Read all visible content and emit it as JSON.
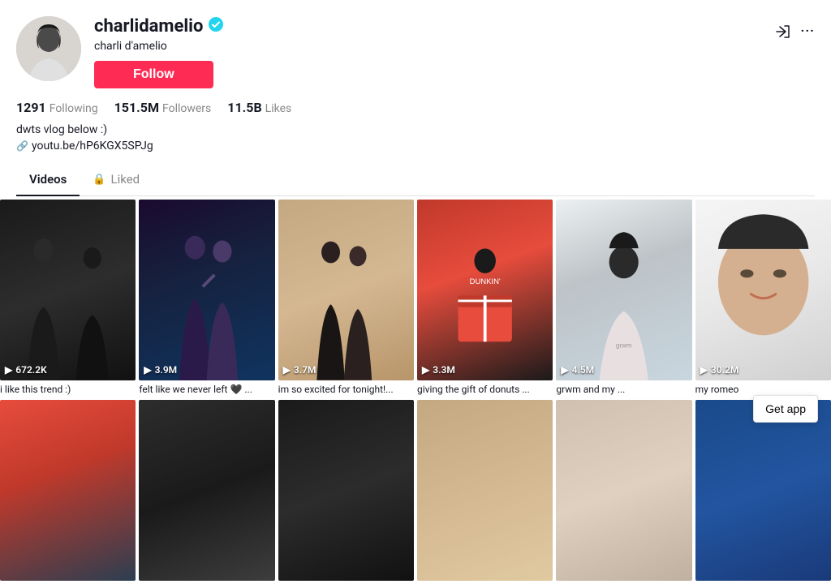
{
  "profile": {
    "username": "charlidamelio",
    "display_name": "charli d'amelio",
    "verified": true,
    "follow_label": "Follow",
    "stats": {
      "following_count": "1291",
      "following_label": "Following",
      "followers_count": "151.5M",
      "followers_label": "Followers",
      "likes_count": "11.5B",
      "likes_label": "Likes"
    },
    "bio": "dwts vlog below :)",
    "link": "youtu.be/hP6KGX5SPJg"
  },
  "tabs": [
    {
      "label": "Videos",
      "active": true
    },
    {
      "label": "Liked",
      "locked": true
    }
  ],
  "videos": [
    {
      "id": 1,
      "views": "672.2K",
      "title": "i like this trend :)",
      "thumb_class": "thumb-1"
    },
    {
      "id": 2,
      "views": "3.9M",
      "title": "felt like we never left 🖤 ...",
      "thumb_class": "thumb-2"
    },
    {
      "id": 3,
      "views": "3.7M",
      "title": "im so excited for tonight!...",
      "thumb_class": "thumb-3"
    },
    {
      "id": 4,
      "views": "3.3M",
      "title": "giving the gift of donuts ...",
      "thumb_class": "thumb-4"
    },
    {
      "id": 5,
      "views": "4.5M",
      "title": "grwm and my ...",
      "thumb_class": "thumb-5"
    },
    {
      "id": 6,
      "views": "30.2M",
      "title": "my romeo",
      "thumb_class": "thumb-6"
    },
    {
      "id": 7,
      "views": "",
      "title": "",
      "thumb_class": "thumb-7"
    },
    {
      "id": 8,
      "views": "",
      "title": "",
      "thumb_class": "thumb-8"
    },
    {
      "id": 9,
      "views": "",
      "title": "",
      "thumb_class": "thumb-9"
    },
    {
      "id": 10,
      "views": "",
      "title": "",
      "thumb_class": "thumb-10"
    },
    {
      "id": 11,
      "views": "",
      "title": "",
      "thumb_class": "thumb-11"
    },
    {
      "id": 12,
      "views": "",
      "title": "",
      "thumb_class": "thumb-12"
    }
  ],
  "get_app_label": "Get app",
  "icons": {
    "share": "↗",
    "more": "···",
    "play": "▶",
    "lock": "🔒",
    "link": "🔗",
    "verified_symbol": "✓"
  }
}
